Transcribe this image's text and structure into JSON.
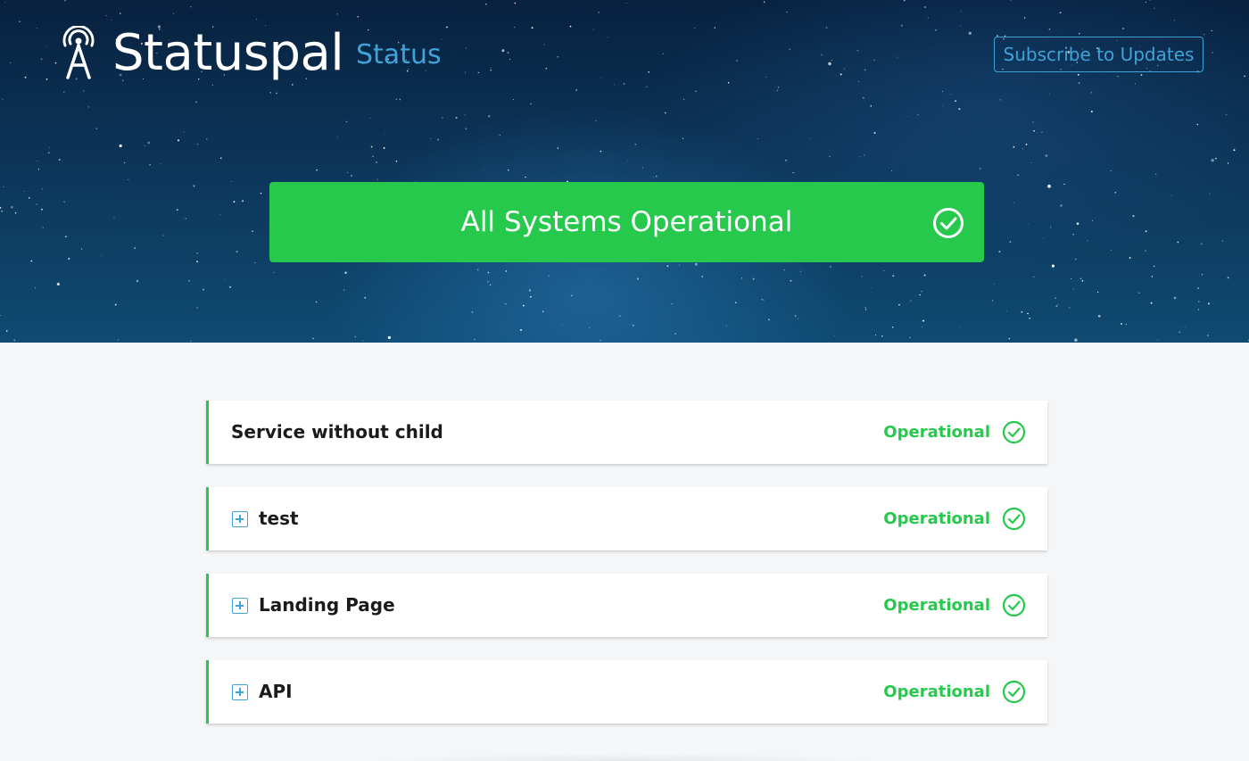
{
  "header": {
    "brand": "Statuspal",
    "brand_sub": "Status",
    "subscribe_label": "Subscribe to Updates",
    "logo_icon": "antenna-signal-icon"
  },
  "banner": {
    "text": "All Systems Operational",
    "icon": "check-circle-icon",
    "color": "#27c94d"
  },
  "services": [
    {
      "name": "Service without child",
      "status": "Operational",
      "expandable": false
    },
    {
      "name": "test",
      "status": "Operational",
      "expandable": true
    },
    {
      "name": "Landing Page",
      "status": "Operational",
      "expandable": true
    },
    {
      "name": "API",
      "status": "Operational",
      "expandable": true
    }
  ],
  "colors": {
    "accent": "#3fa3d8",
    "operational": "#27c94d",
    "background": "#f4f6f8"
  }
}
